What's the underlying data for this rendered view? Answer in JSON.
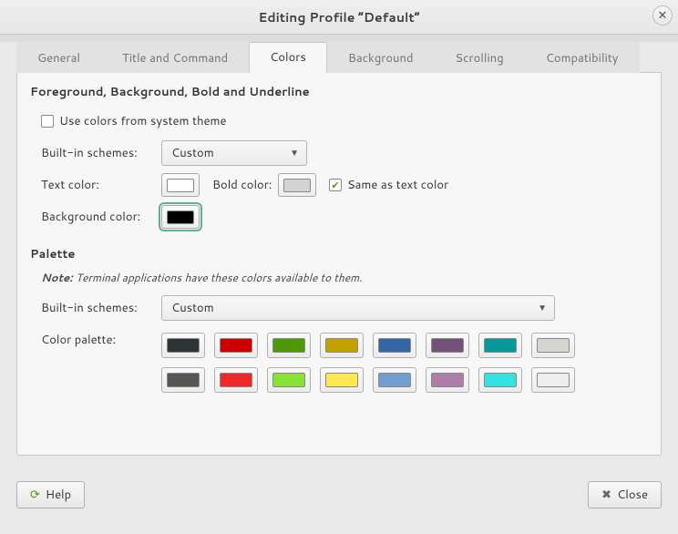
{
  "title": "Editing Profile “Default”",
  "tabs": [
    {
      "label": "General"
    },
    {
      "label": "Title and Command"
    },
    {
      "label": "Colors"
    },
    {
      "label": "Background"
    },
    {
      "label": "Scrolling"
    },
    {
      "label": "Compatibility"
    }
  ],
  "active_tab": "Colors",
  "section1": {
    "heading": "Foreground, Background, Bold and Underline",
    "use_system_label": "Use colors from system theme",
    "use_system_checked": false,
    "builtin_schemes_label": "Built-in schemes:",
    "builtin_schemes_value": "Custom",
    "text_color_label": "Text color:",
    "text_color": "#ffffff",
    "bold_color_label": "Bold color:",
    "bold_color": "#d3d3d3",
    "same_as_text_label": "Same as text color",
    "same_as_text_checked": true,
    "bg_color_label": "Background color:",
    "bg_color": "#000000"
  },
  "section2": {
    "heading": "Palette",
    "note_prefix": "Note:",
    "note_body": "Terminal applications have these colors available to them.",
    "builtin_schemes_label": "Built-in schemes:",
    "builtin_schemes_value": "Custom",
    "color_palette_label": "Color palette:",
    "palette": [
      "#2e3436",
      "#cc0000",
      "#4e9a06",
      "#c4a000",
      "#3465a4",
      "#75507b",
      "#06989a",
      "#d3d7cf",
      "#555753",
      "#ef2929",
      "#8ae234",
      "#fce94f",
      "#729fcf",
      "#ad7fa8",
      "#34e2e2",
      "#eeeeec"
    ]
  },
  "buttons": {
    "help": "Help",
    "close": "Close"
  }
}
